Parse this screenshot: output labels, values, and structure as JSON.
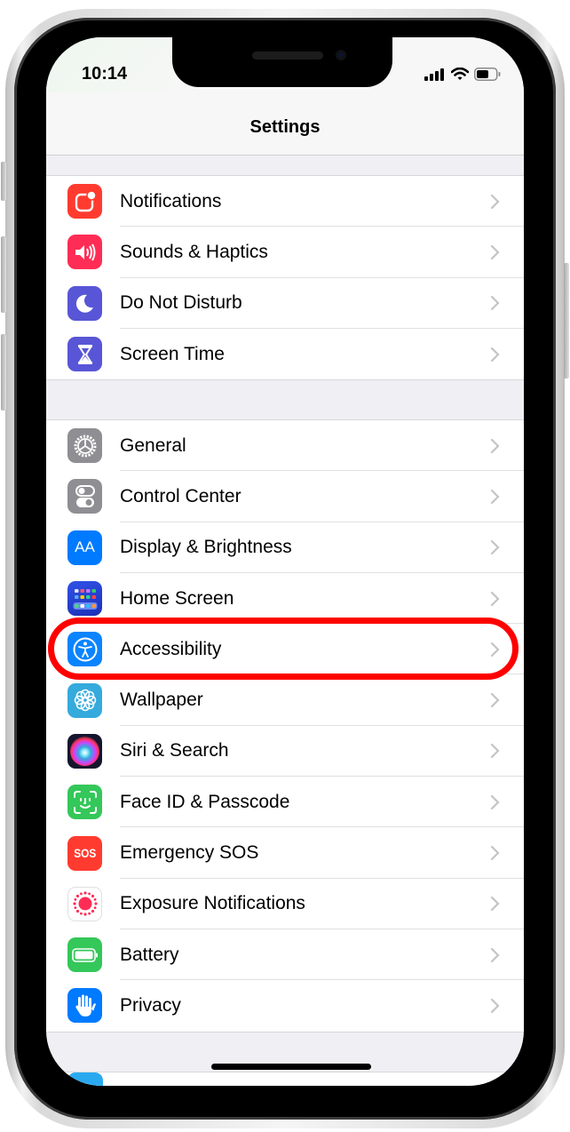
{
  "status_bar": {
    "time": "10:14",
    "signal_icon": "cellular-signal-icon",
    "wifi_icon": "wifi-icon",
    "battery_icon": "battery-icon"
  },
  "header": {
    "title": "Settings"
  },
  "colors": {
    "highlight": "#ff0000",
    "chevron": "#c4c4c7",
    "separator": "#e0e0e3",
    "background": "#efeff4"
  },
  "groups": [
    {
      "items": [
        {
          "label": "Notifications",
          "icon": "notifications-icon",
          "color": "#ff3b30"
        },
        {
          "label": "Sounds & Haptics",
          "icon": "speaker-icon",
          "color": "#ff2d55"
        },
        {
          "label": "Do Not Disturb",
          "icon": "moon-icon",
          "color": "#5856d6"
        },
        {
          "label": "Screen Time",
          "icon": "hourglass-icon",
          "color": "#5856d6"
        }
      ]
    },
    {
      "items": [
        {
          "label": "General",
          "icon": "gear-icon",
          "color": "#8e8e93"
        },
        {
          "label": "Control Center",
          "icon": "toggles-icon",
          "color": "#8e8e93"
        },
        {
          "label": "Display & Brightness",
          "icon": "text-size-icon",
          "color": "#007aff"
        },
        {
          "label": "Home Screen",
          "icon": "app-grid-icon",
          "color": "#2c47d6"
        },
        {
          "label": "Accessibility",
          "icon": "accessibility-icon",
          "color": "#0a84ff",
          "highlighted": true
        },
        {
          "label": "Wallpaper",
          "icon": "flower-icon",
          "color": "#35aadc"
        },
        {
          "label": "Siri & Search",
          "icon": "siri-icon",
          "color": "#1c1c3a"
        },
        {
          "label": "Face ID & Passcode",
          "icon": "face-id-icon",
          "color": "#34c759"
        },
        {
          "label": "Emergency SOS",
          "icon": "sos-icon",
          "color": "#ff3b30"
        },
        {
          "label": "Exposure Notifications",
          "icon": "exposure-icon",
          "color": "#ffffff"
        },
        {
          "label": "Battery",
          "icon": "battery-icon",
          "color": "#34c759"
        },
        {
          "label": "Privacy",
          "icon": "hand-icon",
          "color": "#007aff"
        }
      ]
    }
  ],
  "sos_text": "SOS",
  "aa_text": "AA"
}
